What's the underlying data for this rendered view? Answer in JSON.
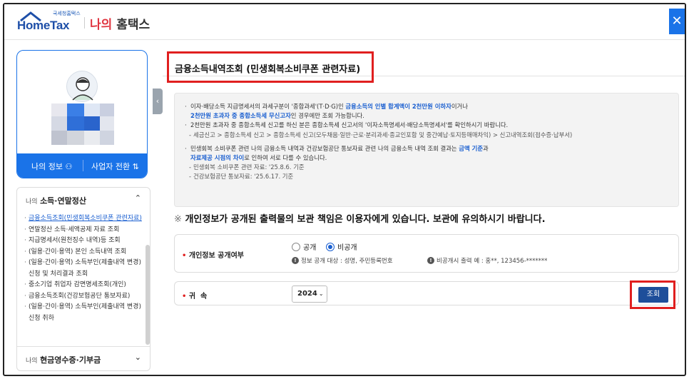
{
  "header": {
    "logo_small": "국세청홈택스",
    "logo_main": "HomeTax",
    "title_part1": "나의",
    "title_part2": "홈택스",
    "close_icon": "close-icon"
  },
  "sidebar": {
    "profile": {
      "my_info_label": "나의 정보",
      "my_info_icon": "person-icon",
      "switch_label": "사업자 전환",
      "switch_icon": "swap-icon"
    },
    "section1": {
      "prefix": "나의",
      "title": "소득·연말정산",
      "items": [
        "금융소득조회(민생회복소비쿠폰 관련자료)",
        "연말정산 소득·세액공제 자료 조회",
        "지급명세서(원천징수 내역)등 조회",
        "(일용·간이·용역) 본인 소득내역 조회",
        "(일용·간이·용역) 소득부인(제출내역 변경) 신청 및 처리결과 조회",
        "중소기업 취업자 감면명세조회(개인)",
        "금융소득조회(건강보험공단 통보자료)",
        "(일용·간이·용역) 소득부인(제출내역 변경) 신청 취하"
      ]
    },
    "section2": {
      "prefix": "나의",
      "title": "현금영수증·기부금"
    }
  },
  "main": {
    "page_title": "금융소득내역조회 (민생회복소비쿠폰 관련자료)",
    "notice": {
      "l1a": "이자·배당소득 지급명세서의 과세구분이 '종합과세'(T·D·G)인 ",
      "l1b": "금융소득의 인별 합계액이 2천만원 이하자",
      "l1c": "이거나",
      "l2a": "2천만원 초과자 중 종합소득세 무신고자",
      "l2b": "인 경우에만 조회 가능합니다.",
      "l3": "2천만원 초과자 중 종합소득세 신고를 하신 분은 종합소득세 신고서의 '이자소득명세서·배당소득명세서'를 확인하시기 바랍니다.",
      "l4": "세금신고 > 종합소득세 신고 > 종합소득세 신고(모두채움·일반·근로·분리과세·종교인포함 및 중간예납·토지등매매차익) > 신고내역조회(접수증·납부서)",
      "l5a": "민생회복 소비쿠폰 관련 나의 금융소득 내역과 건강보험공단 통보자료 관련 나의 금융소득 내역 조회 결과는 ",
      "l5b": "금액 기준",
      "l5c": "과",
      "l6a": "자료제공 시점의 차이",
      "l6b": "로 인하여 서로 다를 수 있습니다.",
      "l7": "민생회복 소비쿠폰 관련 자료: '25.8.6. 기준",
      "l8": "건강보험공단 통보자료: '25.6.17. 기준"
    },
    "warning": "개인정보가 공개된 출력물의 보관 책임은 이용자에게 있습니다. 보관에 유의하시기 바랍니다.",
    "warning_mark": "※",
    "privacy": {
      "label": "개인정보 공개여부",
      "option_public": "공개",
      "option_private": "비공개",
      "selected": "비공개",
      "info1": "정보 공개 대상 : 성명, 주민등록번호",
      "info2": "비공개시 출력 예 : 홍**, 123456-*******"
    },
    "year": {
      "label": "귀  속",
      "value": "2024"
    },
    "search_button": "조회"
  },
  "colors": {
    "accent": "#1a73e8",
    "highlight": "#e01f1f",
    "button": "#1e4e9a"
  }
}
